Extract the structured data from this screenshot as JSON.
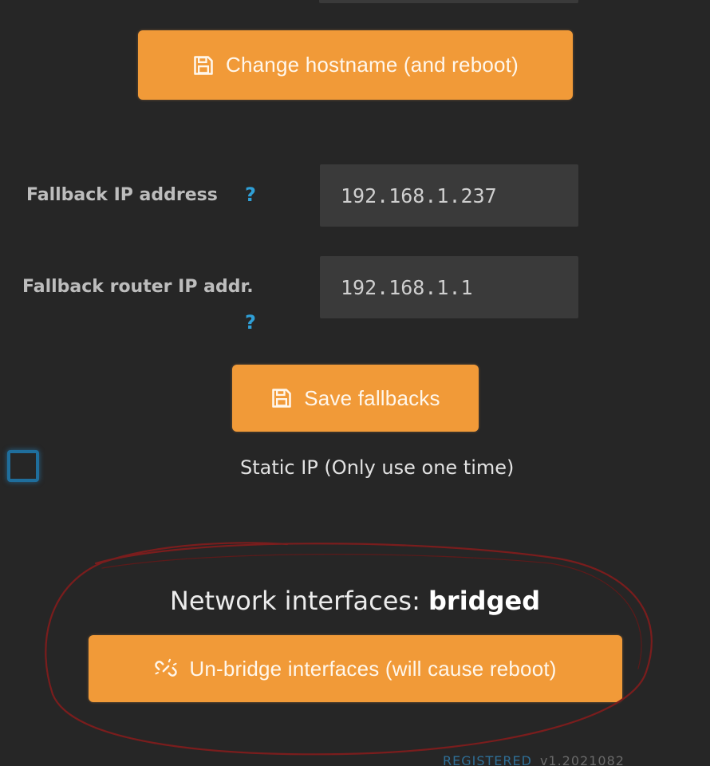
{
  "hostname_section": {
    "button_label": "Change hostname (and reboot)",
    "button_icon": "floppy-disk-icon"
  },
  "fallbacks": {
    "ip_label": "Fallback IP address",
    "ip_help": "?",
    "ip_value": "192.168.1.237",
    "router_label": "Fallback router IP addr.",
    "router_help": "?",
    "router_value": "192.168.1.1",
    "save_label": "Save fallbacks",
    "save_icon": "floppy-disk-icon"
  },
  "static_ip": {
    "checked": false,
    "label": "Static IP (Only use one time)"
  },
  "network": {
    "heading_prefix": "Network interfaces: ",
    "heading_value": "bridged",
    "unbridge_label": "Un-bridge interfaces (will cause reboot)",
    "unbridge_icon": "unlink-icon"
  },
  "footer": {
    "registered": "REGISTERED",
    "version": "v1.2021082"
  },
  "colors": {
    "background": "#262626",
    "accent_button": "#f19a38",
    "input_bg": "#3a3a3a",
    "help_blue": "#2f9fd6",
    "annotation_red": "#7a1d1d"
  }
}
